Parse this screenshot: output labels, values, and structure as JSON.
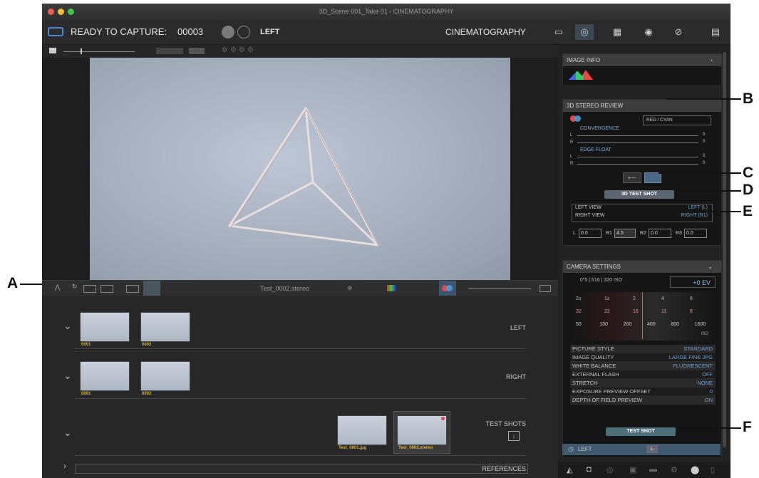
{
  "window": {
    "title": "3D_Scene 001_Take 01 - CINEMATOGRAPHY"
  },
  "toolbar": {
    "status": "READY TO CAPTURE:",
    "counter": "00003",
    "side": "LEFT",
    "mode": "CINEMATOGRAPHY"
  },
  "filmstrip": {
    "filename": "Test_0002.stereo"
  },
  "browser": {
    "groups": [
      {
        "label": "LEFT",
        "thumbs": [
          "0001",
          "0002"
        ]
      },
      {
        "label": "RIGHT",
        "thumbs": [
          "0001",
          "0002"
        ]
      },
      {
        "label": "TEST SHOTS",
        "thumbs": [
          "Test_0001.jpg",
          "Test_0002.stereo"
        ]
      },
      {
        "label": "REFERENCES"
      }
    ]
  },
  "image_info": {
    "title": "IMAGE INFO"
  },
  "stereo_review": {
    "title": "3D STEREO REVIEW",
    "anaglyph": "RED / CYAN",
    "convergence": "CONVERGENCE",
    "edge_float": "EDGE FLOAT",
    "slider_l": "L",
    "slider_r": "R",
    "zero": "0",
    "test_shot": "3D TEST SHOT",
    "views": [
      {
        "label": "LEFT VIEW",
        "value": "LEFT (L)"
      },
      {
        "label": "RIGHT VIEW",
        "value": "RIGHT (R1)"
      }
    ],
    "fields": [
      {
        "label": "L",
        "value": "0.0"
      },
      {
        "label": "R1",
        "value": "4.5"
      },
      {
        "label": "R2",
        "value": "0.0"
      },
      {
        "label": "R3",
        "value": "0.0"
      }
    ]
  },
  "camera": {
    "title": "CAMERA SETTINGS",
    "summary": "0\"5 | f/16 | 320 ISO",
    "ev": "+0 EV",
    "shutter_ticks": [
      "2s",
      "1s",
      "2",
      "4",
      "8"
    ],
    "aperture_ticks": [
      "32",
      "22",
      "16",
      "11",
      "8"
    ],
    "iso_ticks": [
      "50",
      "100",
      "200",
      "400",
      "800",
      "1600"
    ],
    "iso_label": "ISO",
    "settings": [
      {
        "label": "PICTURE STYLE",
        "value": "STANDARD"
      },
      {
        "label": "IMAGE QUALITY",
        "value": "LARGE FINE JPG"
      },
      {
        "label": "WHITE BALANCE",
        "value": "FLUORESCENT"
      },
      {
        "label": "EXTERNAL FLASH",
        "value": "OFF"
      },
      {
        "label": "STRETCH",
        "value": "NONE"
      },
      {
        "label": "EXPOSURE PREVIEW OFFSET",
        "value": "0"
      },
      {
        "label": "DEPTH OF FIELD PREVIEW",
        "value": "ON"
      }
    ],
    "test_shot": "TEST SHOT",
    "footer_side": "LEFT",
    "footer_badge": "L"
  },
  "callouts": [
    "A",
    "B",
    "C",
    "D",
    "E",
    "F"
  ]
}
